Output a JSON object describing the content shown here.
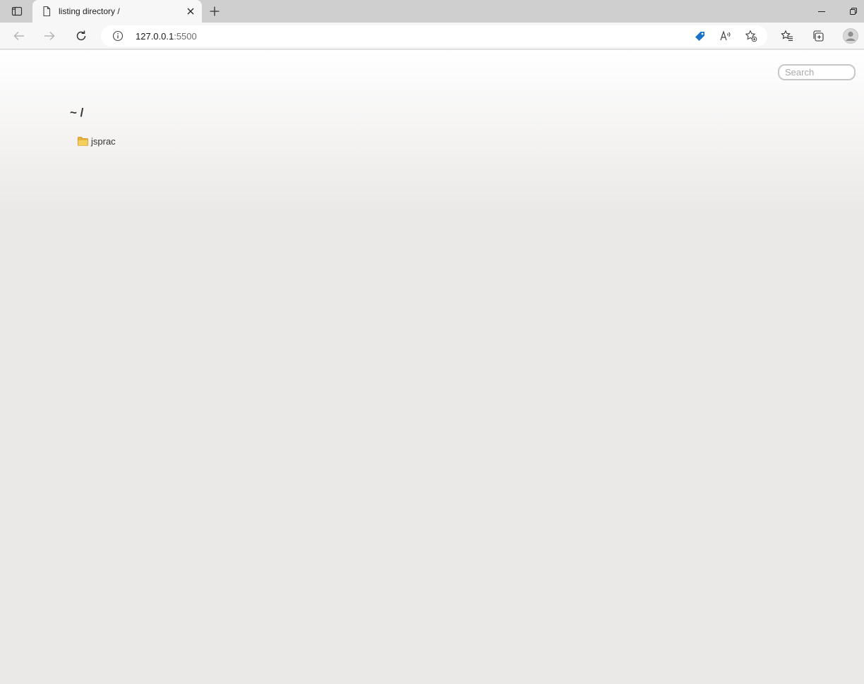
{
  "browser": {
    "tab": {
      "title": "listing directory /"
    },
    "address": {
      "host": "127.0.0.1",
      "port": ":5500"
    }
  },
  "page": {
    "search_placeholder": "Search",
    "heading": "~ /",
    "entries": [
      {
        "name": "jsprac",
        "type": "folder",
        "icon": "folder-icon"
      }
    ]
  },
  "colors": {
    "tag_icon": "#1a73c8",
    "folder": "#f5c842"
  }
}
